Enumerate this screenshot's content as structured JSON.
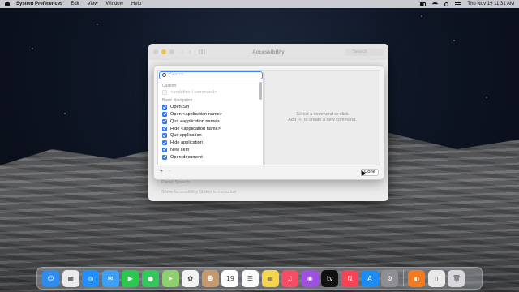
{
  "menubar": {
    "app_name": "System Preferences",
    "menus": [
      "Edit",
      "View",
      "Window",
      "Help"
    ],
    "clock": "Thu Nov 19  11:31 AM"
  },
  "pref_window": {
    "title": "Accessibility",
    "search_placeholder": "Search",
    "bg_line1": "Prefer Speech",
    "bg_line2": "Show Accessibility Status in menu bar"
  },
  "sheet": {
    "search_placeholder": "Search",
    "section_custom": "Custom",
    "undefined_command": "<undefined command>",
    "section_basic": "Basic Navigation",
    "commands": [
      "Open Siri",
      "Open <application name>",
      "Quit <application name>",
      "Hide <application name>",
      "Quit application",
      "Hide application",
      "New item",
      "Open document"
    ],
    "add_symbol": "+",
    "remove_symbol": "−",
    "placeholder_line1": "Select a command or click",
    "placeholder_line2": "Add (+) to create a new command.",
    "done_label": "Done"
  },
  "dock": {
    "apps": [
      {
        "name": "Finder",
        "glyph": "☺",
        "color": "#2d8cf0"
      },
      {
        "name": "Launchpad",
        "glyph": "▦",
        "color": "#e9e9ee"
      },
      {
        "name": "Safari",
        "glyph": "◎",
        "color": "#1e90ff"
      },
      {
        "name": "Mail",
        "glyph": "✉",
        "color": "#3da0f5"
      },
      {
        "name": "FaceTime",
        "glyph": "▶",
        "color": "#2cc84d"
      },
      {
        "name": "Messages",
        "glyph": "●",
        "color": "#34c759"
      },
      {
        "name": "Maps",
        "glyph": "➤",
        "color": "#8fcf6d"
      },
      {
        "name": "Photos",
        "glyph": "✿",
        "color": "#f2f2f2"
      },
      {
        "name": "Contacts",
        "glyph": "☻",
        "color": "#c49a6c"
      },
      {
        "name": "Calendar",
        "glyph": "19",
        "color": "#ffffff"
      },
      {
        "name": "Reminders",
        "glyph": "☰",
        "color": "#fafafa"
      },
      {
        "name": "Notes",
        "glyph": "▤",
        "color": "#f7d54a"
      },
      {
        "name": "Music",
        "glyph": "♫",
        "color": "#f74c63"
      },
      {
        "name": "Podcasts",
        "glyph": "◉",
        "color": "#a050e0"
      },
      {
        "name": "TV",
        "glyph": "tv",
        "color": "#111111"
      },
      {
        "name": "News",
        "glyph": "N",
        "color": "#f54456"
      },
      {
        "name": "App Store",
        "glyph": "A",
        "color": "#1c8cf5"
      },
      {
        "name": "System Preferences",
        "glyph": "⚙",
        "color": "#8e8e93"
      },
      {
        "name": "Firefox",
        "glyph": "◐",
        "color": "#f57a1f"
      },
      {
        "name": "Documents",
        "glyph": "▯",
        "color": "#e8e8e8"
      },
      {
        "name": "Trash",
        "glyph": "🗑",
        "color": "#d8d8dc"
      }
    ]
  }
}
